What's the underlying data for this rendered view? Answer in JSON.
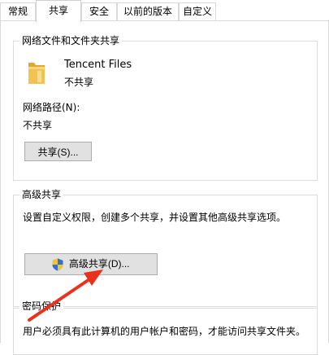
{
  "tabs": [
    {
      "label": "常规",
      "selected": false
    },
    {
      "label": "共享",
      "selected": true
    },
    {
      "label": "安全",
      "selected": false
    },
    {
      "label": "以前的版本",
      "selected": false
    },
    {
      "label": "自定义",
      "selected": false
    }
  ],
  "network_sharing": {
    "group_title": "网络文件和文件夹共享",
    "folder_name": "Tencent Files",
    "folder_status": "不共享",
    "folder_icon": "folder-icon",
    "path_label": "网络路径(N):",
    "path_value": "不共享",
    "share_button": "共享(S)..."
  },
  "advanced_sharing": {
    "group_title": "高级共享",
    "description": "设置自定义权限，创建多个共享，并设置其他高级共享选项。",
    "button": "高级共享(D)...",
    "button_icon": "uac-shield-icon"
  },
  "password_protection": {
    "group_title": "密码保护",
    "description": "用户必须具有此计算机的用户帐户和密码，才能访问共享文件夹。"
  },
  "annotation": {
    "icon": "red-arrow-icon",
    "color": "#e8321e"
  },
  "colors": {
    "border": "#dcdcdc",
    "button_face": "#e1e1e1",
    "button_border": "#adadad",
    "folder": "#f3c352"
  }
}
